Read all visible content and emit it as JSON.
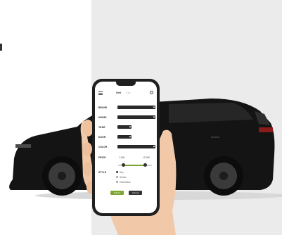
{
  "colors": {
    "accent": "#7ea533",
    "dark": "#2a2a2a",
    "panel": "#ebebeb",
    "car": "#141414"
  },
  "app": {
    "title": "Sell",
    "subtitle": "Car",
    "menu_icon": "menu-icon",
    "search_icon": "search-icon"
  },
  "form": {
    "fields": [
      {
        "label": "BRAND"
      },
      {
        "label": "MODEL"
      },
      {
        "label": "YEAR"
      },
      {
        "label": "DOOR"
      },
      {
        "label": "COLOR"
      }
    ],
    "price": {
      "label": "PRICE",
      "min": "1,000",
      "max": "12,000",
      "range_start": 0.15,
      "range_end": 0.8
    },
    "style": {
      "label": "STYLE",
      "options": [
        "Any",
        "Sedan",
        "Hatchback"
      ],
      "selected": 0
    },
    "buttons": {
      "primary": "Submit",
      "secondary": "Cancel"
    }
  }
}
